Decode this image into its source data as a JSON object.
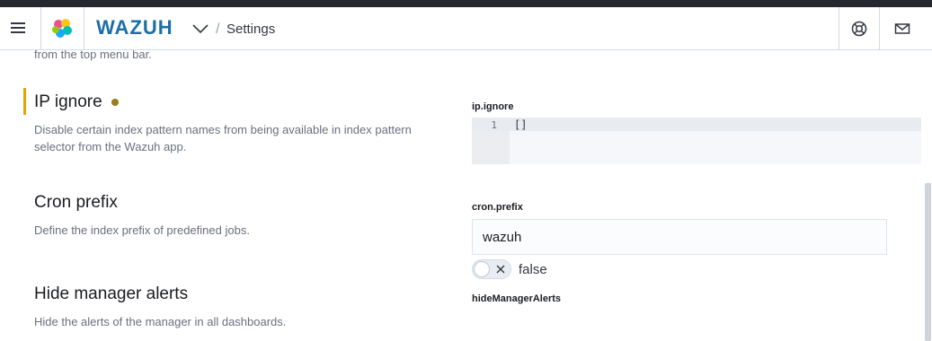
{
  "header": {
    "brand": "WAZUH",
    "breadcrumb": "Settings",
    "icons": [
      "menu-icon",
      "wazuh-logo-icon",
      "chevron-down-icon",
      "help-icon",
      "mail-icon"
    ]
  },
  "content": {
    "clipped_text": "from the top menu bar.",
    "settings": [
      {
        "title": "IP ignore",
        "description": "Disable certain index pattern names from being available in index pattern selector from the Wazuh app.",
        "field_label": "ip.ignore",
        "editor": {
          "line_number": "1",
          "value": "[]"
        }
      },
      {
        "title": "Cron prefix",
        "description": "Define the index prefix of predefined jobs.",
        "field_label": "cron.prefix",
        "value": "wazuh"
      },
      {
        "title": "Hide manager alerts",
        "description": "Hide the alerts of the manager in all dashboards.",
        "field_label": "hideManagerAlerts",
        "switch_label": "false",
        "switch_on": false
      }
    ]
  },
  "colors": {
    "brand": "#1a6fa8",
    "accent_bar": "#e7a400",
    "modified_dot": "#9a7c1a"
  }
}
